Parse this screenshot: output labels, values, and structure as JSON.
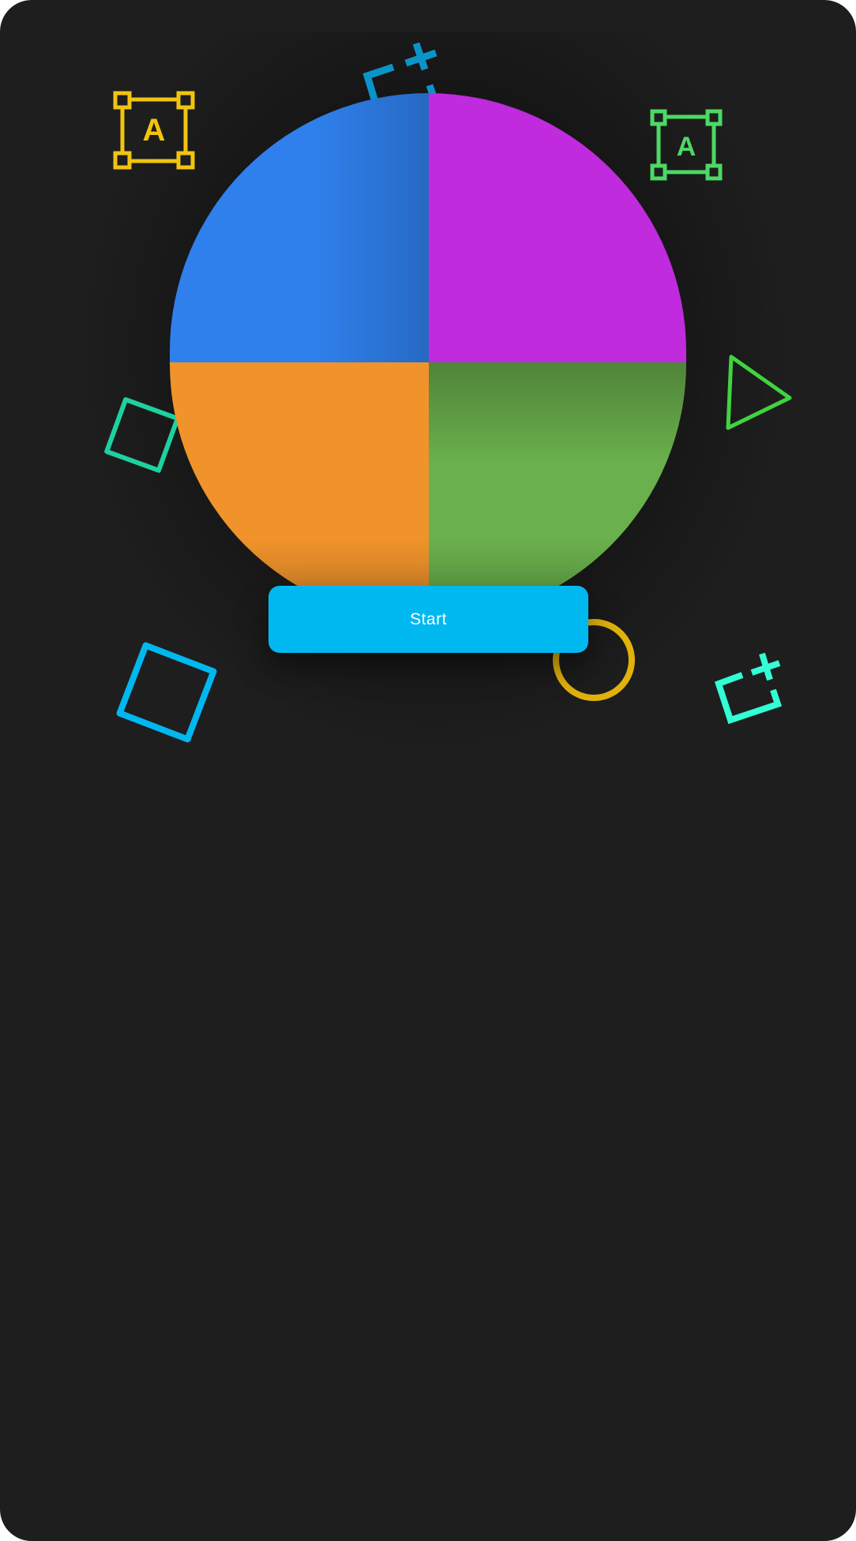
{
  "colors": {
    "background": "#1e1e1e",
    "segment_blue": "#2f80ed",
    "segment_purple": "#bf2bdd",
    "segment_orange": "#f0932b",
    "segment_green": "#6ab04c",
    "button": "#00b8f0",
    "deco_yellow": "#f1c40f",
    "deco_green": "#4cd964",
    "deco_teal": "#1dd1a1",
    "deco_cyan": "#00b8f0",
    "deco_aqua": "#33ffd6"
  },
  "wheel": {
    "segments": [
      "blue",
      "purple",
      "orange",
      "green"
    ]
  },
  "decor": {
    "text_box_label": "A",
    "shapes": [
      "text-box-icon",
      "crop-icon",
      "square-icon",
      "triangle-icon",
      "circle-icon"
    ]
  },
  "start_button": {
    "label": "Start"
  }
}
